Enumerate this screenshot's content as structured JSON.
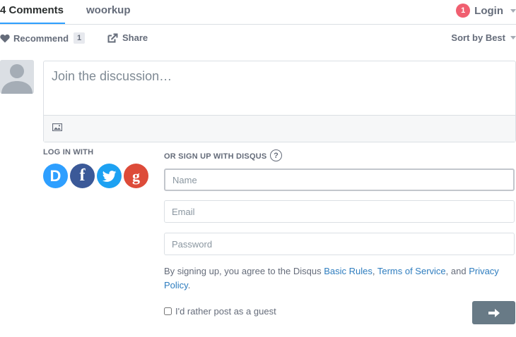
{
  "nav": {
    "comments_tab": "4 Comments",
    "forum_tab": "woorkup",
    "notification_count": "1",
    "login_label": "Login"
  },
  "actions": {
    "recommend_label": "Recommend",
    "recommend_count": "1",
    "share_label": "Share",
    "sort_label": "Sort by Best"
  },
  "compose": {
    "placeholder": "Join the discussion…"
  },
  "login": {
    "login_with_label": "LOG IN WITH",
    "signup_label": "OR SIGN UP WITH DISQUS",
    "help_glyph": "?",
    "social": [
      "D",
      "f",
      "twitter",
      "g"
    ],
    "name_placeholder": "Name",
    "email_placeholder": "Email",
    "password_placeholder": "Password",
    "terms_prefix": "By signing up, you agree to the Disqus ",
    "basic_rules": "Basic Rules",
    "comma": ", ",
    "terms_of_service": "Terms of Service",
    "and": ", and ",
    "privacy_policy": "Privacy Policy",
    "period": ".",
    "guest_label": "I'd rather post as a guest"
  },
  "colors": {
    "accent": "#2e9fff",
    "badge": "#f05f70",
    "submit": "#687a86"
  }
}
